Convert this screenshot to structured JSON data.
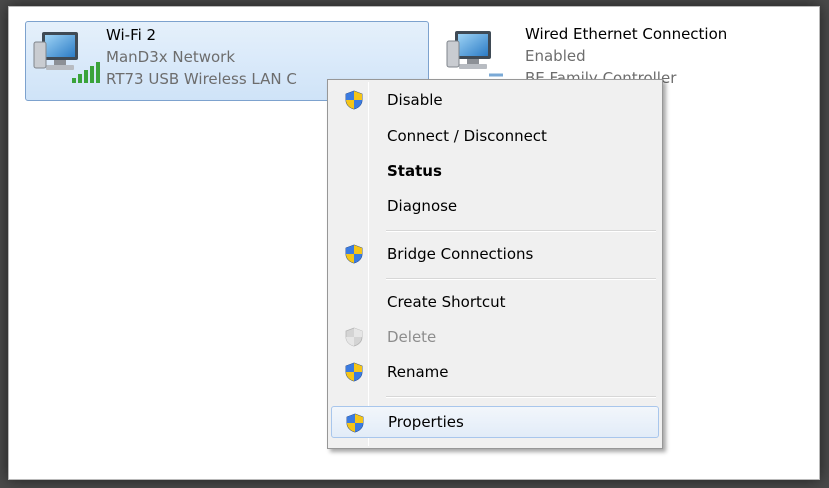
{
  "adapters": {
    "wifi": {
      "name": "Wi-Fi 2",
      "network": "ManD3x Network",
      "device": "RT73 USB Wireless LAN C"
    },
    "wired": {
      "name": "Wired Ethernet Connection",
      "status": "Enabled",
      "device": "BE Family Controller"
    }
  },
  "context_menu": {
    "items": [
      {
        "label": "Disable",
        "icon": "uac-shield-icon"
      },
      {
        "label": "Connect / Disconnect"
      },
      {
        "label": "Status",
        "bold": true
      },
      {
        "label": "Diagnose"
      },
      {
        "label": "Bridge Connections",
        "icon": "uac-shield-icon"
      },
      {
        "label": "Create Shortcut"
      },
      {
        "label": "Delete",
        "icon": "uac-shield-icon",
        "disabled": true
      },
      {
        "label": "Rename",
        "icon": "uac-shield-icon"
      },
      {
        "label": "Properties",
        "icon": "uac-shield-icon",
        "highlighted": true
      }
    ]
  },
  "colors": {
    "selection": "#cfe3f8",
    "signal": "#3aa33a",
    "menu_bg": "#f0f0f0"
  }
}
